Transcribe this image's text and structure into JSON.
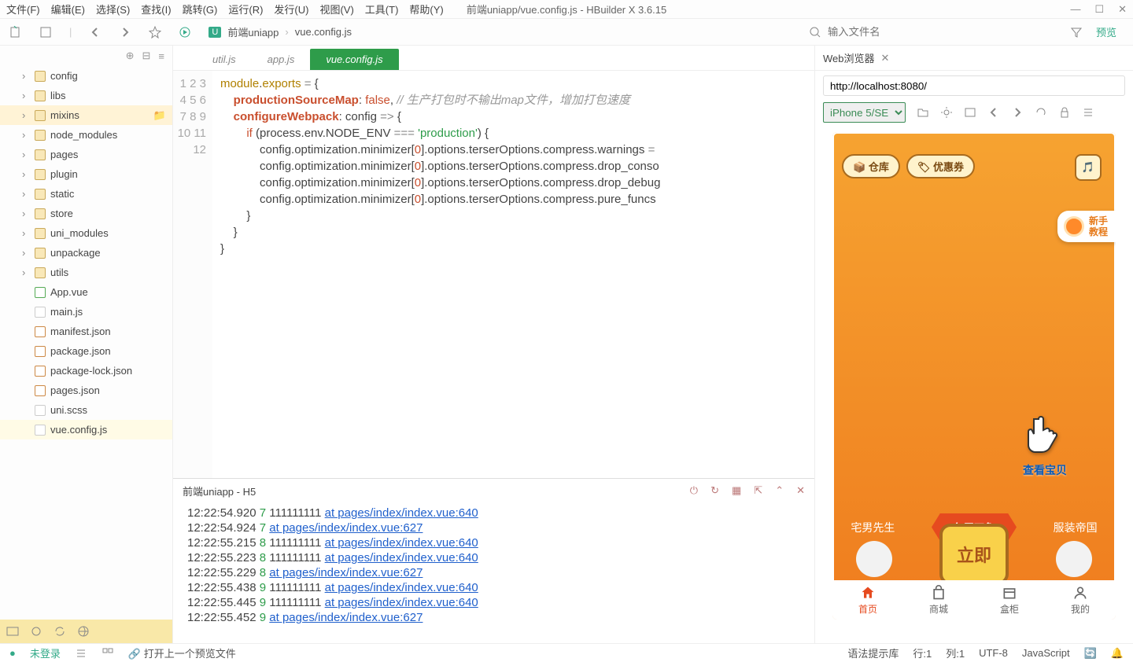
{
  "menu": {
    "items": [
      "文件(F)",
      "编辑(E)",
      "选择(S)",
      "查找(I)",
      "跳转(G)",
      "运行(R)",
      "发行(U)",
      "视图(V)",
      "工具(T)",
      "帮助(Y)"
    ]
  },
  "window_title": "前端uniapp/vue.config.js - HBuilder X 3.6.15",
  "toolbar": {
    "project": "前端uniapp",
    "file": "vue.config.js",
    "search_placeholder": "输入文件名",
    "preview": "预览"
  },
  "tree": {
    "items": [
      {
        "name": "config",
        "type": "folder"
      },
      {
        "name": "libs",
        "type": "folder"
      },
      {
        "name": "mixins",
        "type": "folder",
        "selected": true
      },
      {
        "name": "node_modules",
        "type": "folder"
      },
      {
        "name": "pages",
        "type": "folder"
      },
      {
        "name": "plugin",
        "type": "folder"
      },
      {
        "name": "static",
        "type": "folder"
      },
      {
        "name": "store",
        "type": "folder"
      },
      {
        "name": "uni_modules",
        "type": "folder"
      },
      {
        "name": "unpackage",
        "type": "folder"
      },
      {
        "name": "utils",
        "type": "folder"
      },
      {
        "name": "App.vue",
        "type": "vue"
      },
      {
        "name": "main.js",
        "type": "file"
      },
      {
        "name": "manifest.json",
        "type": "json"
      },
      {
        "name": "package.json",
        "type": "json"
      },
      {
        "name": "package-lock.json",
        "type": "json"
      },
      {
        "name": "pages.json",
        "type": "json"
      },
      {
        "name": "uni.scss",
        "type": "file"
      },
      {
        "name": "vue.config.js",
        "type": "file",
        "active": true
      }
    ]
  },
  "tabs": [
    {
      "label": "util.js"
    },
    {
      "label": "app.js"
    },
    {
      "label": "vue.config.js",
      "active": true
    }
  ],
  "code": {
    "lines": 12,
    "comment": "// 生产打包时不输出map文件，增加打包速度"
  },
  "console": {
    "title": "前端uniapp - H5",
    "rows": [
      {
        "ts": "12:22:54.920",
        "n": "7",
        "msg": "111111111",
        "link": "at pages/index/index.vue:640"
      },
      {
        "ts": "12:22:54.924",
        "n": "7",
        "msg": "",
        "link": "at pages/index/index.vue:627"
      },
      {
        "ts": "12:22:55.215",
        "n": "8",
        "msg": "111111111",
        "link": "at pages/index/index.vue:640"
      },
      {
        "ts": "12:22:55.223",
        "n": "8",
        "msg": "111111111",
        "link": "at pages/index/index.vue:640"
      },
      {
        "ts": "12:22:55.229",
        "n": "8",
        "msg": "",
        "link": "at pages/index/index.vue:627"
      },
      {
        "ts": "12:22:55.438",
        "n": "9",
        "msg": "111111111",
        "link": "at pages/index/index.vue:640"
      },
      {
        "ts": "12:22:55.445",
        "n": "9",
        "msg": "111111111",
        "link": "at pages/index/index.vue:640"
      },
      {
        "ts": "12:22:55.452",
        "n": "9",
        "msg": "",
        "link": "at pages/index/index.vue:627"
      }
    ]
  },
  "preview_panel": {
    "tab": "Web浏览器",
    "url": "http://localhost:8080/",
    "device": "iPhone 5/SE"
  },
  "app": {
    "btn_warehouse": "仓库",
    "btn_coupon": "优惠券",
    "tutorial_l1": "新手",
    "tutorial_l2": "教程",
    "pointer_label": "查看宝贝",
    "cat_left": "宅男先生",
    "cat_main": "包罗万象",
    "cat_right": "服装帝国",
    "big_button": "立即",
    "tabs": [
      "首页",
      "商城",
      "盒柜",
      "我的"
    ]
  },
  "status": {
    "login": "未登录",
    "hint": "打开上一个预览文件",
    "syntax": "语法提示库",
    "line": "行:1",
    "col": "列:1",
    "enc": "UTF-8",
    "lang": "JavaScript"
  }
}
